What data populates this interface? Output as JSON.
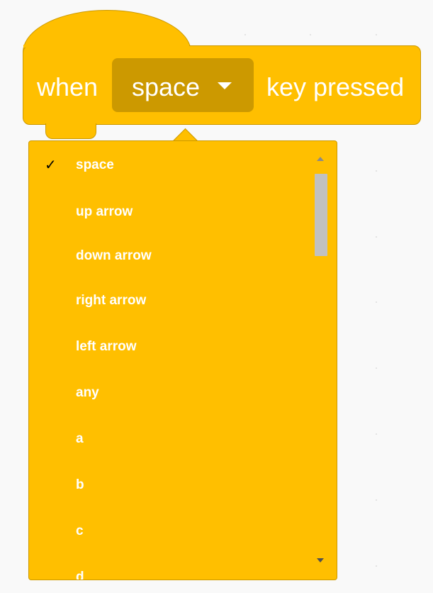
{
  "block": {
    "when_label": "when",
    "key_value": "space",
    "suffix_label": "key pressed",
    "color": "#ffbf00",
    "field_color": "#cc9900",
    "text_color": "#ffffff"
  },
  "dropdown": {
    "selected_mark": "✓",
    "options": [
      {
        "label": "space",
        "selected": true
      },
      {
        "label": "up arrow",
        "selected": false
      },
      {
        "label": "down arrow",
        "selected": false
      },
      {
        "label": "right arrow",
        "selected": false
      },
      {
        "label": "left arrow",
        "selected": false
      },
      {
        "label": "any",
        "selected": false
      },
      {
        "label": "a",
        "selected": false
      },
      {
        "label": "b",
        "selected": false
      },
      {
        "label": "c",
        "selected": false
      },
      {
        "label": "d",
        "selected": false
      }
    ]
  },
  "icons": {
    "field_caret": "caret-down-icon",
    "scroll_up": "scroll-up-arrow-icon",
    "scroll_down": "scroll-down-arrow-icon",
    "check": "checkmark-icon"
  }
}
